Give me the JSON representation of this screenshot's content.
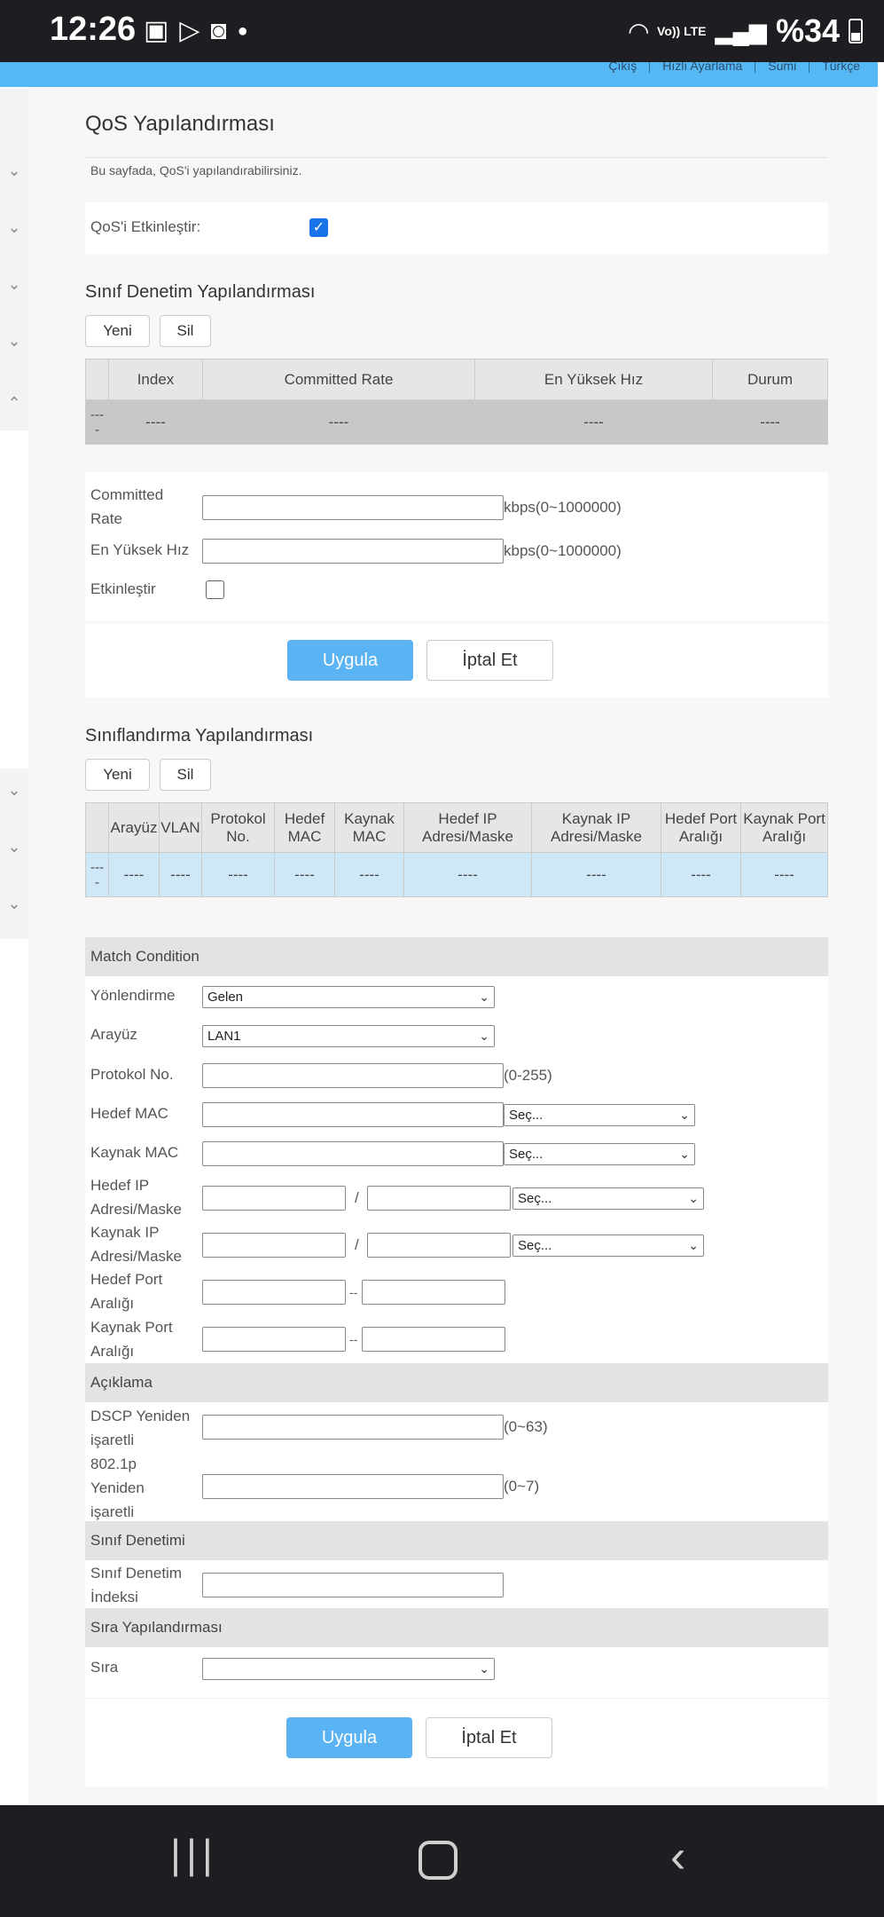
{
  "status_bar": {
    "time": "12:26",
    "notif_icons": [
      "image-icon",
      "play-store-icon",
      "shopping-bag-icon",
      "dot-icon"
    ],
    "volte_label": "Vo)) LTE",
    "battery": "%34"
  },
  "header_links": [
    "Çıkış",
    "Hızlı Ayarlama",
    "Sumi",
    "Türkçe"
  ],
  "page": {
    "title": "QoS Yapılandırması",
    "description": "Bu sayfada, QoS'i yapılandırabilirsiniz.",
    "enable_label": "QoS'i Etkinleştir:",
    "enable_checked": true
  },
  "class_policing": {
    "title": "Sınıf Denetim Yapılandırması",
    "new_label": "Yeni",
    "delete_label": "Sil",
    "table": {
      "columns": [
        "",
        "Index",
        "Committed Rate",
        "En Yüksek Hız",
        "Durum"
      ],
      "rows": [
        [
          "---\n-",
          "----",
          "----",
          "----",
          "----"
        ]
      ]
    },
    "form": {
      "committed_rate_label": "Committed Rate",
      "committed_rate_value": "",
      "committed_rate_unit": "kbps(0~1000000)",
      "max_rate_label": "En Yüksek Hız",
      "max_rate_value": "",
      "max_rate_unit": "kbps(0~1000000)",
      "enable_label": "Etkinleştir",
      "enable_checked": false,
      "apply_label": "Uygula",
      "cancel_label": "İptal Et"
    }
  },
  "classification": {
    "title": "Sınıflandırma Yapılandırması",
    "new_label": "Yeni",
    "delete_label": "Sil",
    "table": {
      "columns": [
        "",
        "Arayüz",
        "VLAN",
        "Protokol No.",
        "Hedef MAC",
        "Kaynak MAC",
        "Hedef IP Adresi/Maske",
        "Kaynak IP Adresi/Maske",
        "Hedef Port Aralığı",
        "Kaynak Port Aralığı"
      ],
      "rows": [
        [
          "---\n-",
          "----",
          "----",
          "----",
          "----",
          "----",
          "----",
          "----",
          "----",
          "----"
        ]
      ]
    },
    "match_condition": {
      "header": "Match Condition",
      "direction_label": "Yönlendirme",
      "direction_value": "Gelen",
      "interface_label": "Arayüz",
      "interface_value": "LAN1",
      "protocol_label": "Protokol No.",
      "protocol_unit": "(0-255)",
      "dst_mac_label": "Hedef MAC",
      "dst_mac_select": "Seç...",
      "src_mac_label": "Kaynak MAC",
      "src_mac_select": "Seç...",
      "dst_ip_label": "Hedef IP Adresi/Maske",
      "dst_ip_select": "Seç...",
      "src_ip_label": "Kaynak IP Adresi/Maske",
      "src_ip_select": "Seç...",
      "slash": "/",
      "dst_port_label": "Hedef Port Aralığı",
      "src_port_label": "Kaynak Port Aralığı",
      "dash": "--"
    },
    "description_section": {
      "header": "Açıklama",
      "dscp_label": "DSCP Yeniden işaretli",
      "dscp_unit": "(0~63)",
      "p8021_label": "802.1p Yeniden işaretli",
      "p8021_unit": "(0~7)"
    },
    "class_policing_section": {
      "header": "Sınıf Denetimi",
      "index_label": "Sınıf Denetim İndeksi"
    },
    "queue_section": {
      "header": "Sıra Yapılandırması",
      "queue_label": "Sıra",
      "queue_value": ""
    },
    "apply_label": "Uygula",
    "cancel_label": "İptal Et"
  },
  "nav_bar": {
    "icons": [
      "recent-apps-icon",
      "home-icon",
      "back-icon"
    ]
  }
}
